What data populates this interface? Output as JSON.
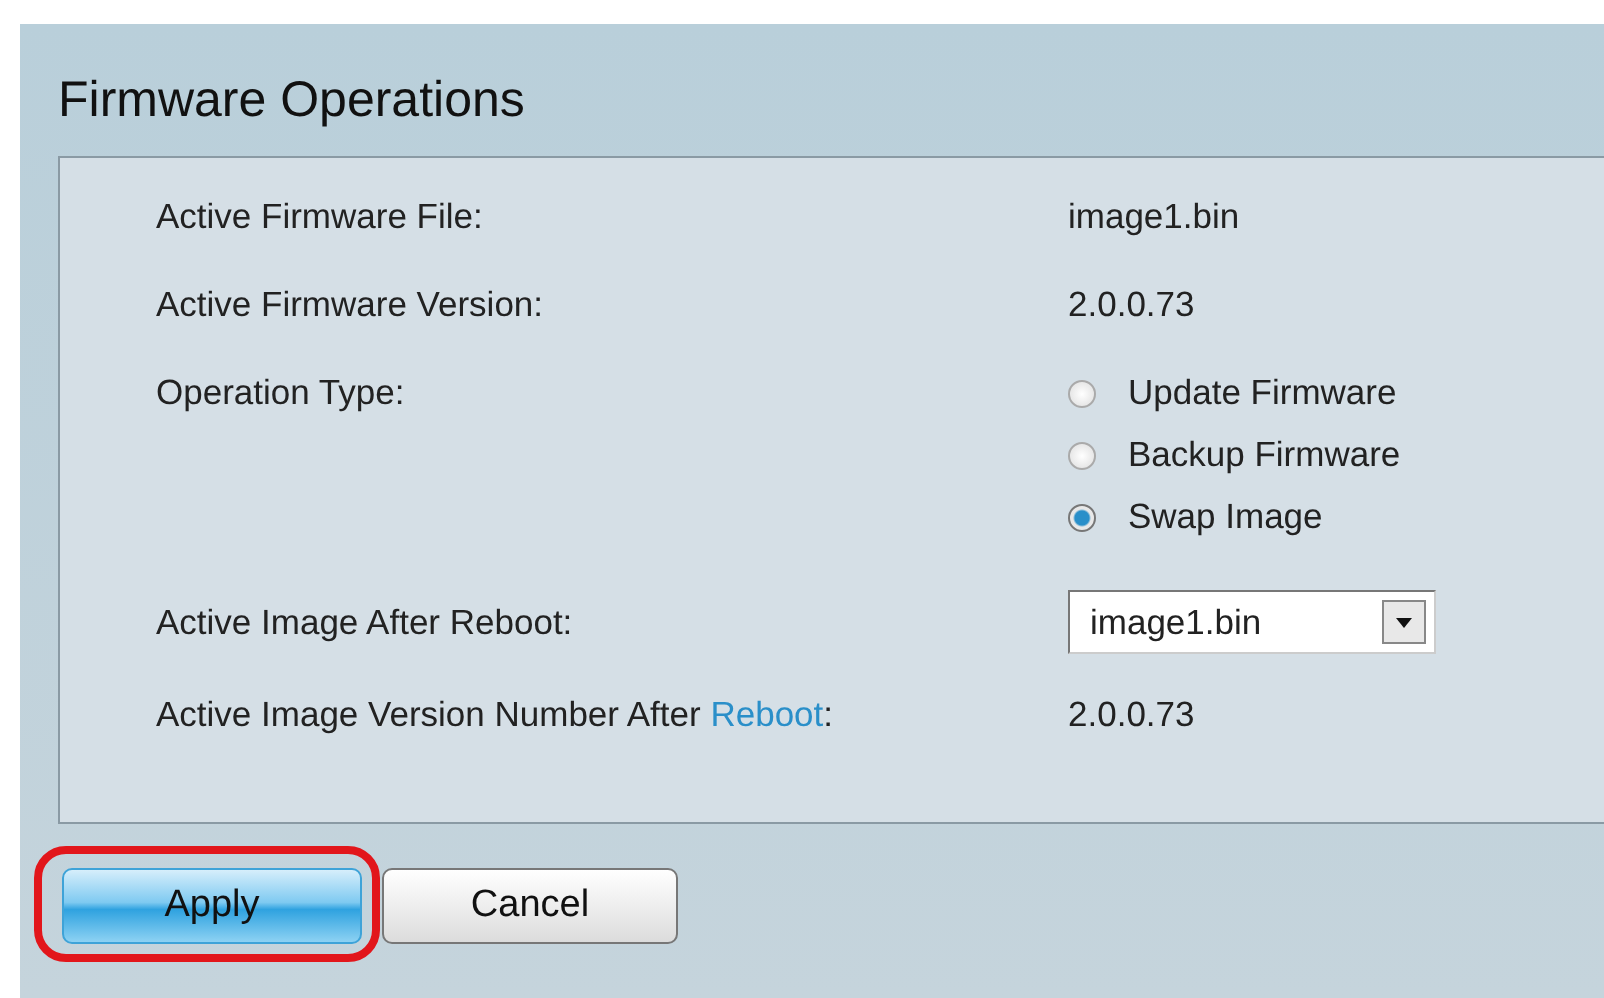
{
  "title": "Firmware Operations",
  "fields": [
    {
      "kind": "text",
      "label": "Active Firmware File:",
      "value": "image1.bin"
    },
    {
      "kind": "text",
      "label": "Active Firmware Version:",
      "value": "2.0.0.73"
    },
    {
      "kind": "radio",
      "label": "Operation Type:",
      "options": [
        {
          "label": "Update Firmware",
          "selected": false
        },
        {
          "label": "Backup Firmware",
          "selected": false
        },
        {
          "label": "Swap Image",
          "selected": true
        }
      ]
    },
    {
      "kind": "select",
      "label": "Active Image After Reboot:",
      "value": "image1.bin"
    },
    {
      "kind": "linktext",
      "label": "Active Image Version Number After ",
      "link": "Reboot",
      "suffix": ":",
      "value": "2.0.0.73"
    }
  ],
  "buttons": [
    {
      "label": "Apply",
      "kind": "primary",
      "highlighted": true
    },
    {
      "label": "Cancel",
      "kind": "secondary",
      "highlighted": false
    }
  ]
}
